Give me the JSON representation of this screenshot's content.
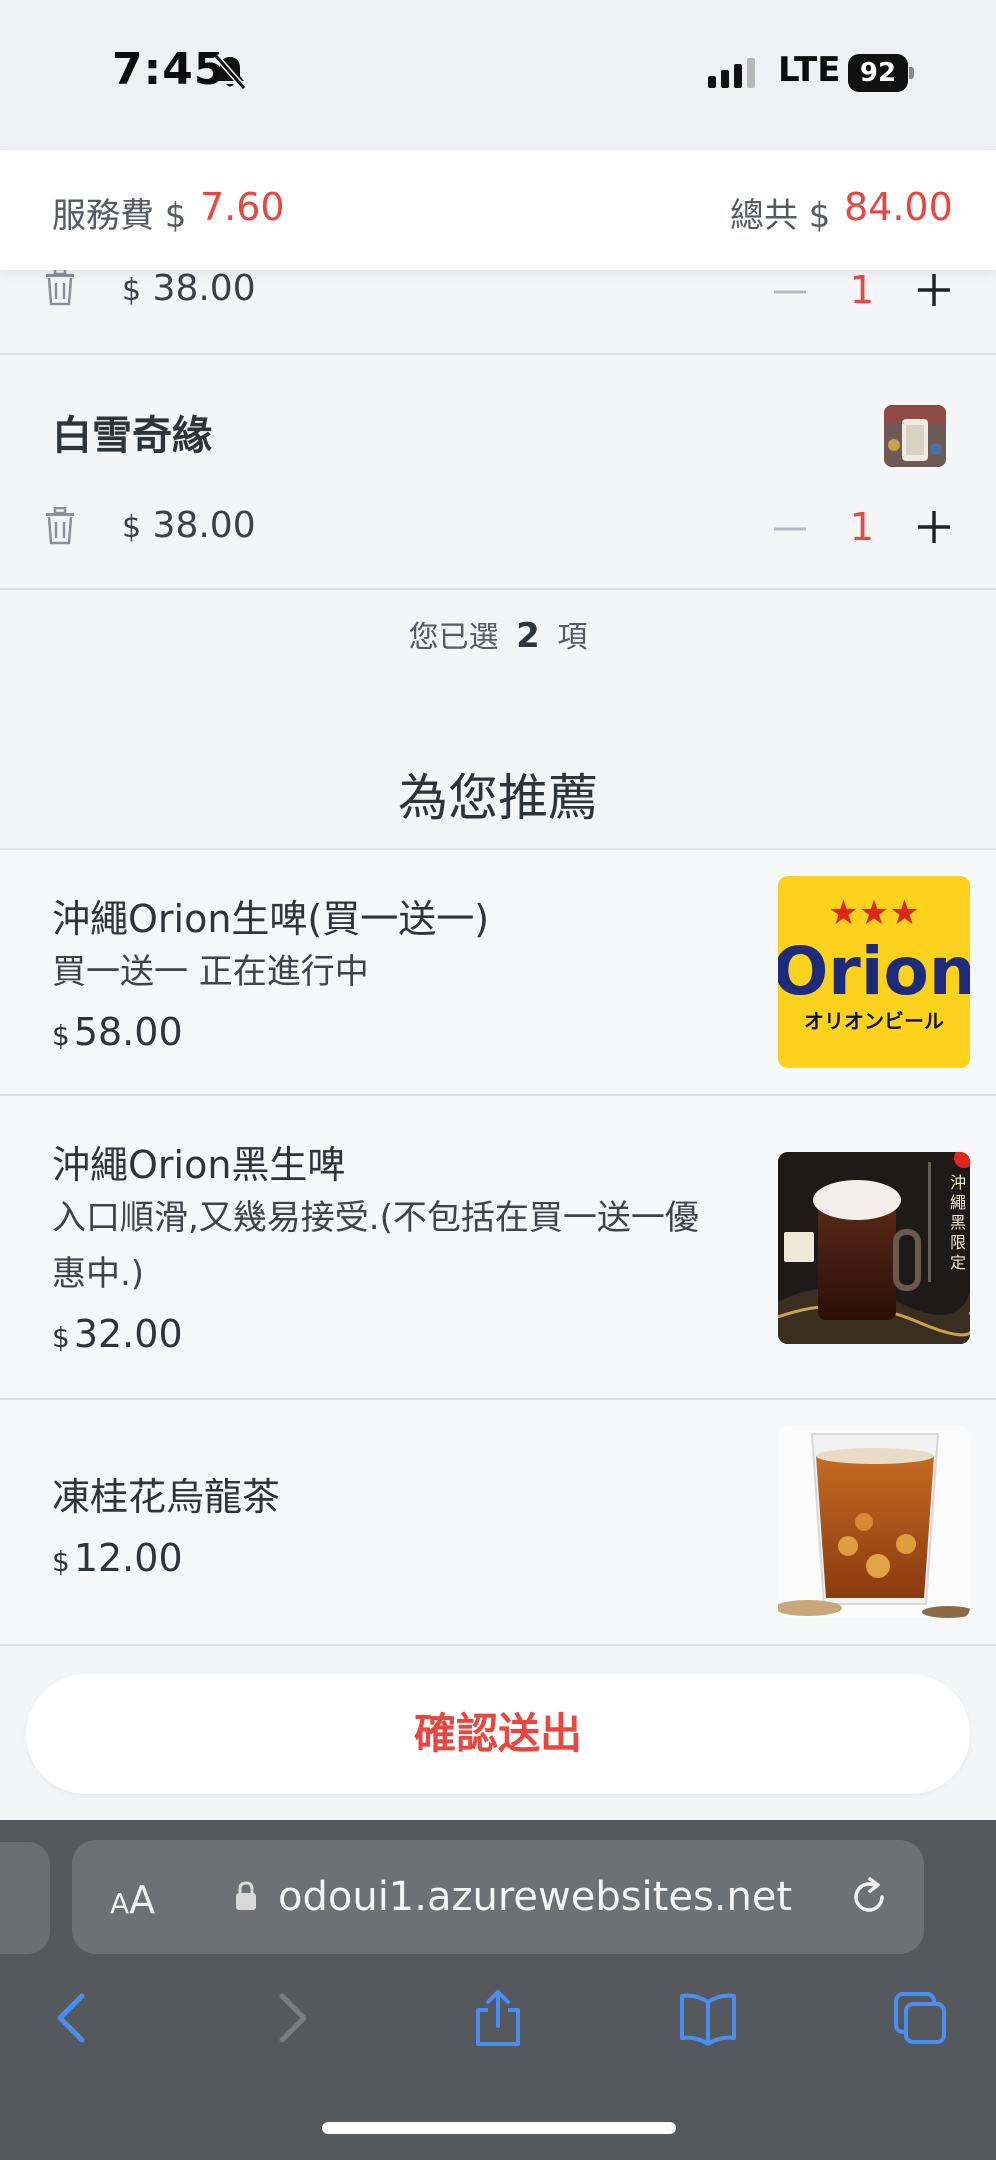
{
  "status_bar": {
    "time": "7:45",
    "network": "LTE",
    "battery": "92"
  },
  "summary": {
    "service_label": "服務費 $",
    "service_value": "7.60",
    "total_label": "總共 $",
    "total_value": "84.00"
  },
  "cart": {
    "items": [
      {
        "name": "",
        "currency": "$",
        "price": "38.00",
        "qty": "1"
      },
      {
        "name": "白雪奇緣",
        "currency": "$",
        "price": "38.00",
        "qty": "1"
      }
    ],
    "selected_prefix": "您已選",
    "selected_count": "2",
    "selected_suffix": "項"
  },
  "recommend": {
    "title": "為您推薦",
    "items": [
      {
        "name": "沖繩Orion生啤(買一送一)",
        "desc": "買一送一  正在進行中",
        "currency": "$",
        "price": "58.00",
        "image": "orion-logo"
      },
      {
        "name": "沖繩Orion黑生啤",
        "desc": "入口順滑,又幾易接受.(不包括在買一送一優惠中.)",
        "currency": "$",
        "price": "32.00",
        "image": "dark-beer-mug"
      },
      {
        "name": "凍桂花烏龍茶",
        "desc": "",
        "currency": "$",
        "price": "12.00",
        "image": "iced-tea-glass"
      }
    ],
    "orion_logo_text": "Orion",
    "orion_logo_sub": "オリオンビール"
  },
  "confirm_label": "確認送出",
  "browser": {
    "aa_small": "A",
    "aa_large": "A",
    "url": "odoui1.azurewebsites.net"
  },
  "colors": {
    "accent": "#e8463f",
    "browser_bg": "#55585c",
    "nav_blue": "#4a8ef0"
  }
}
